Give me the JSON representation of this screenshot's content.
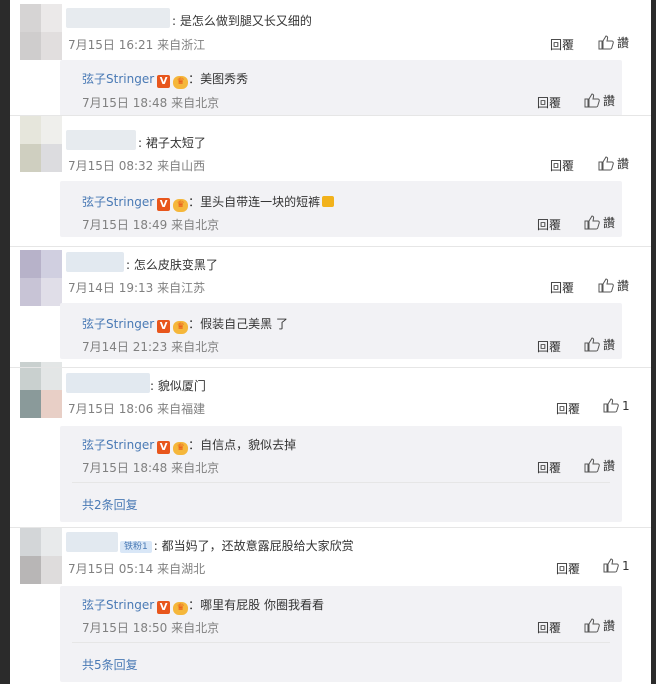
{
  "comments": [
    {
      "text": ": 是怎么做到腿又长又细的",
      "time": "7月15日 16:21",
      "source": "来自浙江",
      "reply_label": "回覆",
      "like_label": "讚",
      "reply": {
        "author": "弦子Stringer",
        "text": "：美图秀秀",
        "time": "7月15日 18:48",
        "source": "来自北京",
        "reply_label": "回覆",
        "like_label": "讚"
      }
    },
    {
      "text": ": 裙子太短了",
      "time": "7月15日 08:32",
      "source": "来自山西",
      "reply_label": "回覆",
      "like_label": "讚",
      "reply": {
        "author": "弦子Stringer",
        "text": "：里头自带连一块的短裤",
        "time": "7月15日 18:49",
        "source": "来自北京",
        "reply_label": "回覆",
        "like_label": "讚"
      }
    },
    {
      "text": ": 怎么皮肤变黑了",
      "time": "7月14日 19:13",
      "source": "来自江苏",
      "reply_label": "回覆",
      "like_label": "讚",
      "reply": {
        "author": "弦子Stringer",
        "text": "：假装自己美黑 了",
        "time": "7月14日 21:23",
        "source": "来自北京",
        "reply_label": "回覆",
        "like_label": "讚"
      }
    },
    {
      "text": ": 貌似厦门",
      "time": "7月15日 18:06",
      "source": "来自福建",
      "reply_label": "回覆",
      "like_label": "1",
      "reply": {
        "author": "弦子Stringer",
        "text": "：自信点，貌似去掉",
        "time": "7月15日 18:48",
        "source": "来自北京",
        "reply_label": "回覆",
        "like_label": "讚"
      },
      "more_replies": "共2条回复"
    },
    {
      "fan_badge": "铁粉1",
      "text": ": 都当妈了，还故意露屁股给大家欣赏",
      "time": "7月15日 05:14",
      "source": "来自湖北",
      "reply_label": "回覆",
      "like_label": "1",
      "reply": {
        "author": "弦子Stringer",
        "text": "：哪里有屁股 你圈我看看",
        "time": "7月15日 18:50",
        "source": "来自北京",
        "reply_label": "回覆",
        "like_label": "讚"
      },
      "more_replies": "共5条回复"
    }
  ],
  "badges": {
    "verified": "V"
  },
  "icons": {
    "like": "thumbs-up-icon",
    "verified": "verified-badge-icon",
    "medal": "fan-medal-icon",
    "shorts": "shorts-emoji-icon"
  },
  "colors": {
    "link": "#4a7ab5",
    "verified": "#e8561c",
    "reply_bg": "#f2f2f5",
    "meta": "#808080"
  }
}
